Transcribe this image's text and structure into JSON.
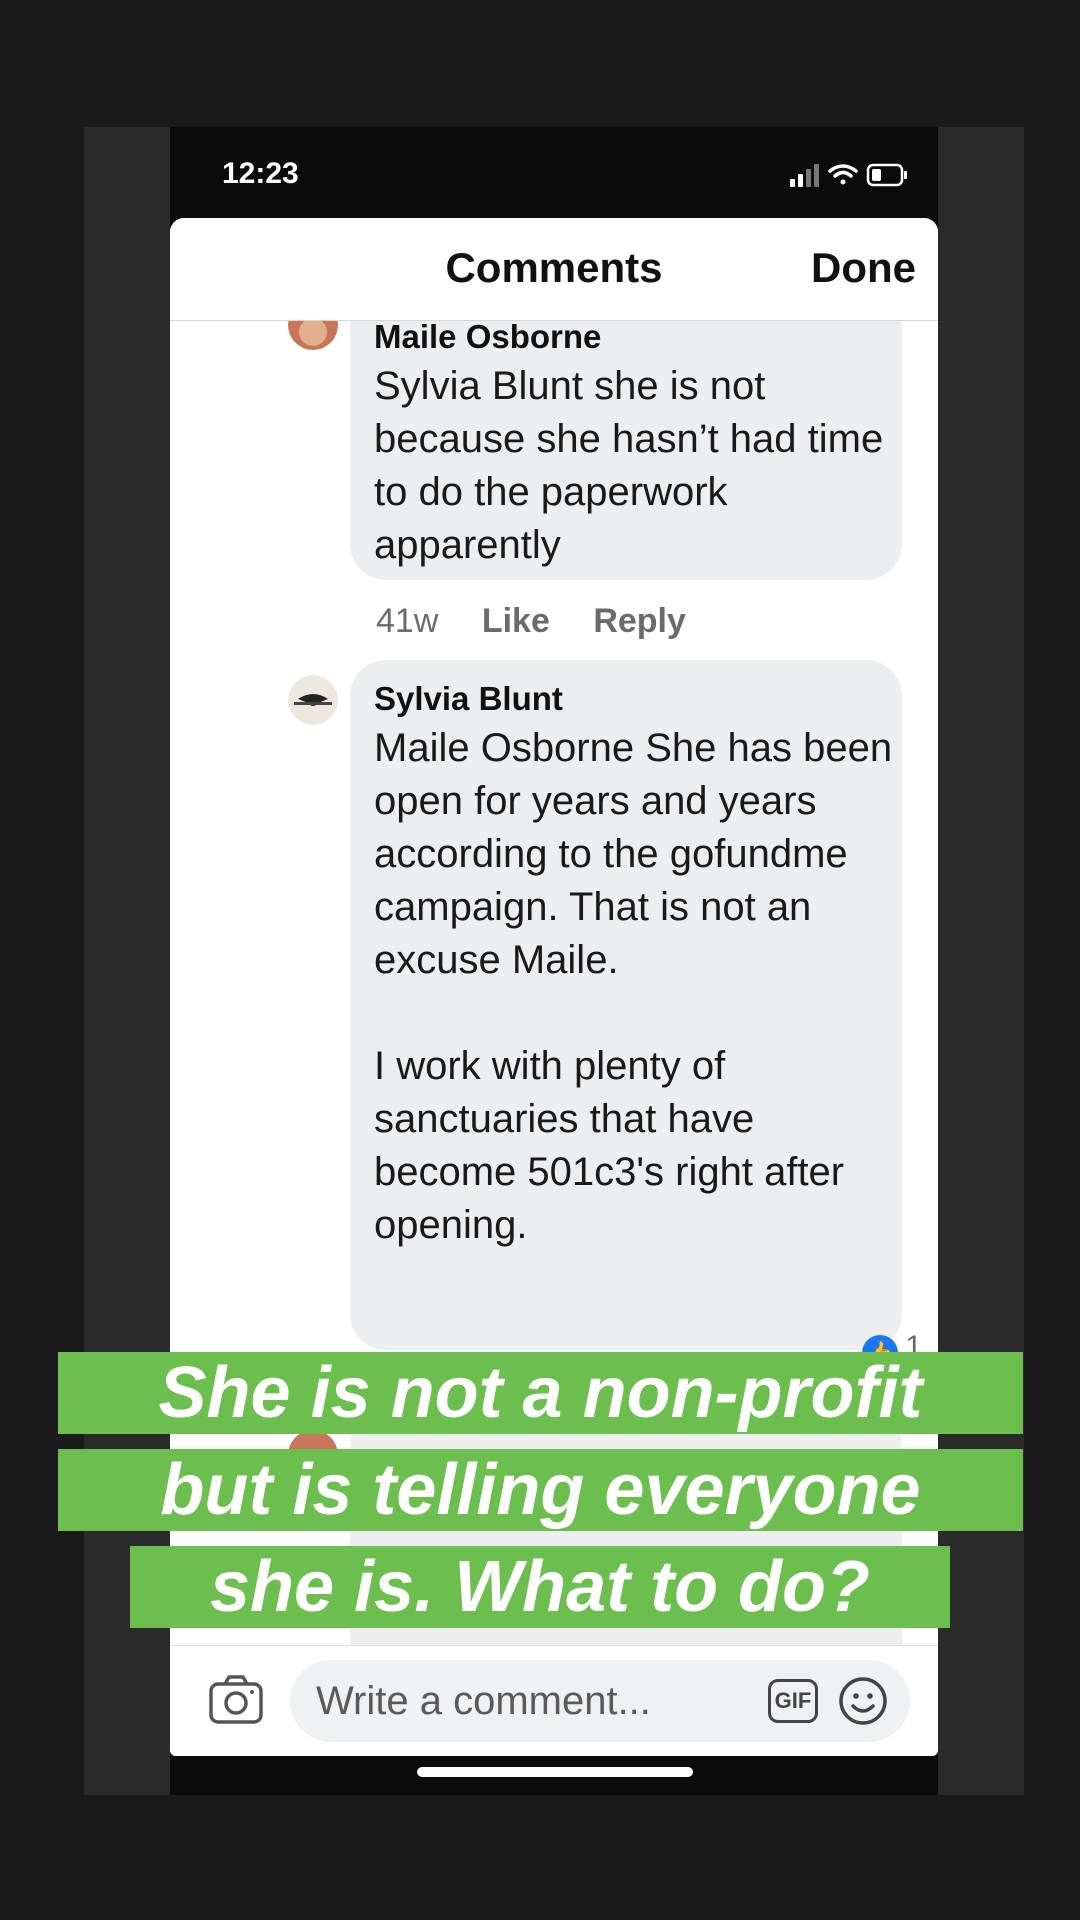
{
  "status_bar": {
    "time": "12:23"
  },
  "sheet": {
    "title": "Comments",
    "done_label": "Done"
  },
  "comments": [
    {
      "author": "Maile Osborne",
      "text": "Sylvia Blunt she is not because she hasn’t had time to do the paperwork apparently",
      "time": "41w",
      "like_label": "Like",
      "reply_label": "Reply"
    },
    {
      "author": "Sylvia Blunt",
      "text": "Maile Osborne She has been open for years and years according to the gofundme campaign. That is not an excuse Maile.\n\nI work with plenty of sanctuaries that have become 501c3's right after opening.",
      "reaction_count": "1"
    }
  ],
  "composer": {
    "placeholder": "Write a comment...",
    "gif_label": "GIF"
  },
  "caption": {
    "lines": [
      "She is not a non-profit",
      "but is telling everyone",
      "she is. What to do?"
    ]
  },
  "colors": {
    "caption_bg": "#6cbf4e",
    "like_blue": "#1877f2"
  }
}
